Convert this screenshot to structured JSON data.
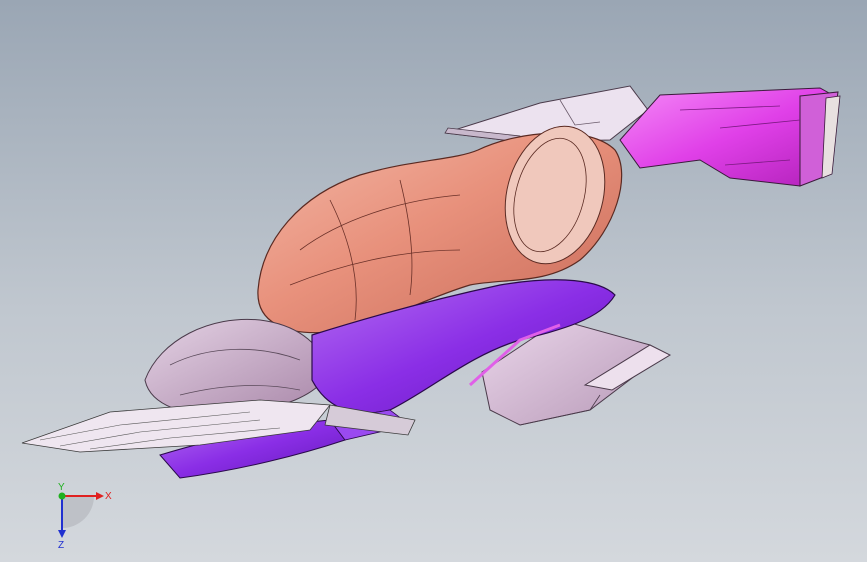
{
  "viewport": {
    "background_top": "#9aa6b4",
    "background_bottom": "#d4d8dd"
  },
  "model": {
    "colors": {
      "outlet_duct": "#e040e8",
      "main_housing": "#e8917c",
      "lower_duct": "#8a2ee6",
      "distribution_box": "#d8b8d8",
      "mount_bracket": "#e2d6e6",
      "rear_assembly": "#c9a9c9"
    }
  },
  "triad": {
    "x_label": "X",
    "y_label": "Y",
    "z_label": "Z",
    "colors": {
      "x": "#e02020",
      "y": "#20b020",
      "z": "#2030d0"
    }
  }
}
